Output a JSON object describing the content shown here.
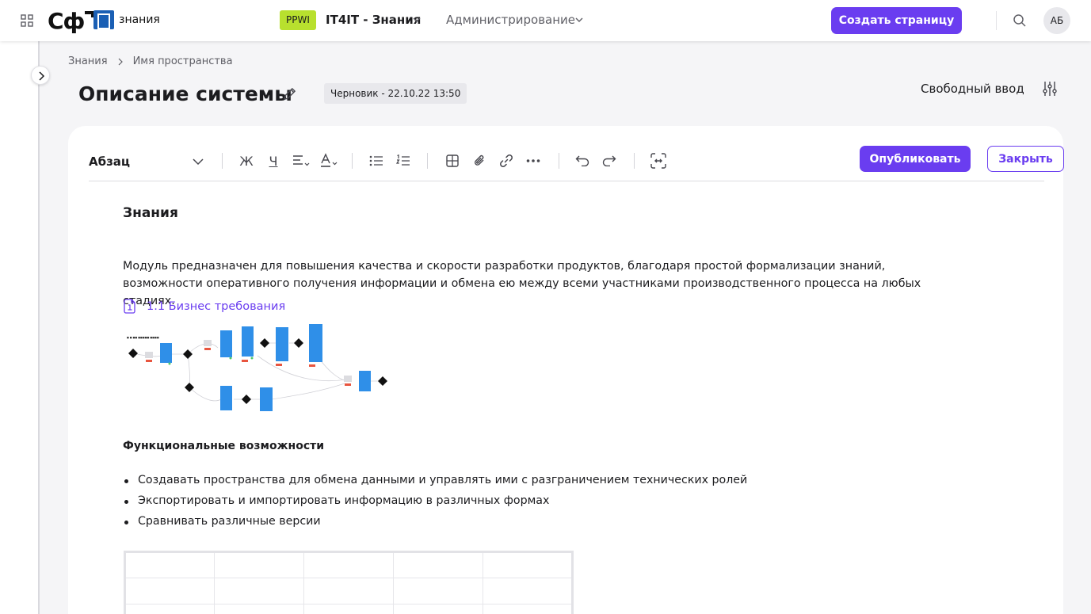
{
  "topbar": {
    "logo_text": "Сф",
    "logo_word": "знания",
    "space_badge": "PPWI",
    "space_name": "IT4IT - Знания",
    "admin_label": "Администрирование",
    "create_button": "Создать страницу",
    "avatar_initials": "АБ"
  },
  "breadcrumb": [
    "Знания",
    "Имя пространства"
  ],
  "page": {
    "title": "Описание системы",
    "status_badge": "Черновик - 22.10.22 13:50",
    "mode_label": "Свободный ввод"
  },
  "toolbar": {
    "block_type": "Абзац",
    "bold_glyph": "Ж",
    "underline_glyph": "Ч",
    "publish_button": "Опубликовать",
    "close_button": "Закрыть",
    "tools": [
      "chevron-down-icon",
      "bold-icon",
      "underline-icon",
      "align-icon",
      "text-color-icon",
      "bullet-list-icon",
      "numbered-list-icon",
      "table-icon",
      "attachment-icon",
      "link-icon",
      "more-icon",
      "undo-icon",
      "redo-icon",
      "fullscreen-icon"
    ]
  },
  "doc": {
    "heading": "Знания",
    "paragraph": "Модуль предназначен для повышения качества и скорости разработки продуктов, благодаря простой формализации знаний, возможности оперативного получения информации и обмена ею между всеми участниками производственного процесса на любых стадиях.",
    "link_text": "1.1 Бизнес требования",
    "section_heading": "Функциональные возможности",
    "bullets": [
      "Создавать пространства для обмена данными и управлять ими с разграничением технических ролей",
      "Экспортировать и импортировать информацию в различных формах",
      "Сравнивать различные версии"
    ],
    "table": {
      "rows": 3,
      "cols": 5
    }
  },
  "colors": {
    "accent": "#6a3df0",
    "badge_green": "#b8e02e",
    "diagram_blue": "#2f8fe8",
    "logo_blue": "#1a5fb4"
  }
}
